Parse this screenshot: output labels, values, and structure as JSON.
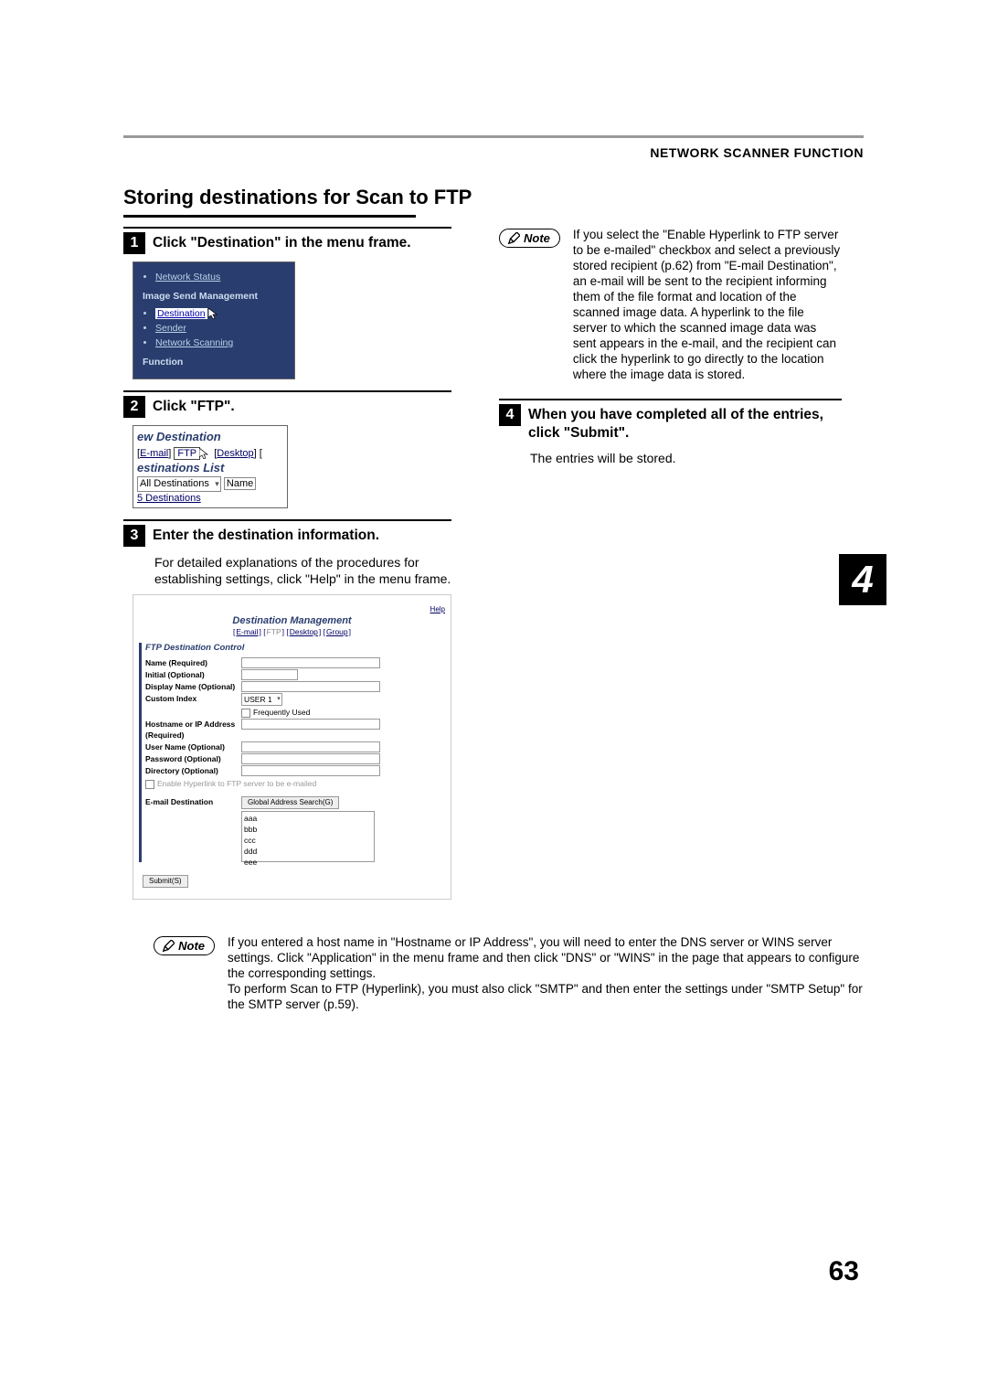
{
  "header": {
    "section": "NETWORK SCANNER FUNCTION"
  },
  "title": "Storing destinations for Scan to FTP",
  "chapter": "4",
  "pageNumber": "63",
  "steps": {
    "s1": {
      "num": "1",
      "title": "Click \"Destination\" in the menu frame."
    },
    "s2": {
      "num": "2",
      "title": "Click \"FTP\"."
    },
    "s3": {
      "num": "3",
      "title": "Enter the destination information.",
      "body": "For detailed explanations of the procedures for establishing settings, click \"Help\" in the menu frame."
    },
    "s4": {
      "num": "4",
      "title": "When you have completed all of the entries, click \"Submit\".",
      "body": "The entries will be stored."
    }
  },
  "noteLabel": "Note",
  "notes": {
    "right": "If you select the \"Enable Hyperlink to FTP server to be e-mailed\" checkbox and select a previously stored recipient (p.62) from \"E-mail Destination\", an e-mail will be sent to the recipient informing them of the file format and location of the scanned image data. A hyperlink to the file server to which the scanned image data was sent appears in the e-mail, and the recipient can click the hyperlink to go directly to the location where the image data is stored.",
    "bottom": "If you entered a host name in \"Hostname or IP Address\", you will need to enter the DNS server or WINS server settings. Click \"Application\" in the menu frame and then click \"DNS\" or \"WINS\" in the page that appears to configure the corresponding settings.\nTo perform Scan to FTP (Hyperlink), you must also click \"SMTP\" and then enter the settings under \"SMTP Setup\" for the SMTP server (p.59)."
  },
  "ss1": {
    "items": [
      "Network Status"
    ],
    "heading": "Image Send Management",
    "menu": [
      "Destination",
      "Sender",
      "Network Scanning"
    ],
    "functionHdr": "Function"
  },
  "ss2": {
    "hdr1": "ew Destination",
    "tabs": [
      "E-mail",
      "FTP",
      "Desktop"
    ],
    "hdr2": "estinations List",
    "filter": "All Destinations",
    "col": "Name",
    "count": "5 Destinations"
  },
  "ss3": {
    "help": "Help",
    "title": "Destination Management",
    "tabs": [
      "E-mail",
      "FTP",
      "Desktop",
      "Group"
    ],
    "blockTitle": "FTP Destination Control",
    "rows": {
      "name": "Name (Required)",
      "initial": "Initial (Optional)",
      "display": "Display Name (Optional)",
      "custom": "Custom Index",
      "customSel": "USER 1",
      "freq": "Frequently Used",
      "host": "Hostname or IP Address (Required)",
      "user": "User Name (Optional)",
      "pass": "Password (Optional)",
      "dir": "Directory (Optional)",
      "enable": "Enable Hyperlink to FTP server to be e-mailed",
      "emaildest": "E-mail Destination",
      "globalBtn": "Global Address Search(G)",
      "list": [
        "aaa",
        "bbb",
        "ccc",
        "ddd",
        "eee"
      ],
      "submit": "Submit(S)"
    }
  }
}
